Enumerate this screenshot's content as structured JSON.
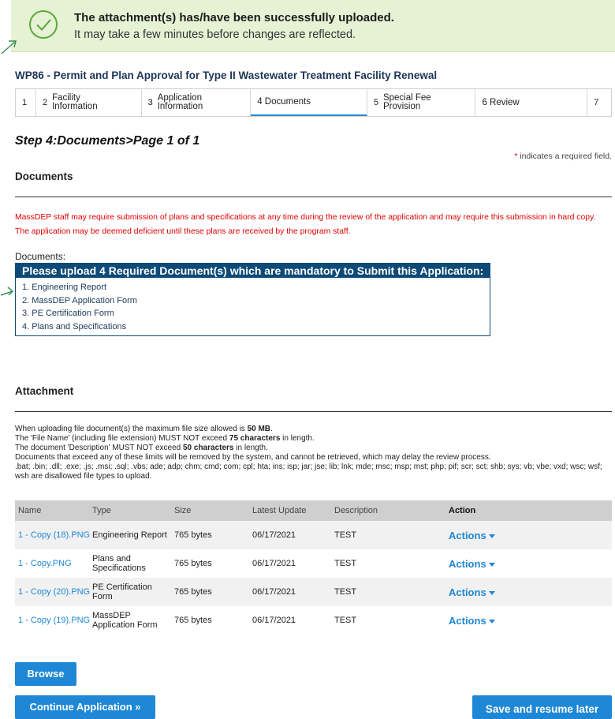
{
  "banner": {
    "title": "The attachment(s) has/have been successfully uploaded.",
    "subtitle": "It may take a few minutes before changes are reflected."
  },
  "page_title": "WP86 - Permit and Plan Approval for Type II Wastewater Treatment Facility Renewal",
  "steps": [
    {
      "num": "1",
      "label": ""
    },
    {
      "num": "2",
      "label": "Facility Information"
    },
    {
      "num": "3",
      "label": "Application Information"
    },
    {
      "num": "",
      "label": "4 Documents"
    },
    {
      "num": "5",
      "label": "Special Fee Provision"
    },
    {
      "num": "",
      "label": "6 Review"
    },
    {
      "num": "7",
      "label": ""
    }
  ],
  "step_heading": "Step 4:Documents>Page 1 of 1",
  "required_note": {
    "star": "*",
    "text": " indicates a required field."
  },
  "documents_section": {
    "title": "Documents",
    "notice": "MassDEP staff may require submission of plans and specifications at any time during the review of the application and may require this submission in hard copy. The application may be deemed deficient until these plans are received by the program staff.",
    "label": "Documents:",
    "required_header": "Please upload 4 Required Document(s) which are mandatory to Submit this Application:",
    "required_items": [
      "1. Engineering Report",
      "2. MassDEP Application Form",
      "3. PE Certification Form",
      "4. Plans and Specifications"
    ]
  },
  "attachment_section": {
    "title": "Attachment",
    "rule1_pre": "When uploading file document(s) the maximum file size allowed is ",
    "rule1_bold": "50 MB",
    "rule1_post": ".",
    "rule2_pre": "The 'File Name' (including file extension) MUST NOT exceed ",
    "rule2_bold": "75 characters",
    "rule2_post": " in length.",
    "rule3_pre": "The document 'Description' MUST NOT exceed ",
    "rule3_bold": "50 characters",
    "rule3_post": " in length.",
    "rule4": "Documents that exceed any of these limits will be removed by the system, and cannot be retrieved, which may delay the review process.",
    "rule5": ".bat; .bin; .dll; .exe; .js; .msi; .sql; .vbs; ade; adp; chm; cmd; com; cpl; hta; ins; isp; jar; jse; lib; lnk; mde; msc; msp; mst; php; pif; scr; sct; shb; sys; vb; vbe; vxd; wsc; wsf; wsh are disallowed file types to upload."
  },
  "table": {
    "headers": [
      "Name",
      "Type",
      "Size",
      "Latest Update",
      "Description",
      "Action"
    ],
    "rows": [
      {
        "name": "1 - Copy (18).PNG",
        "type": "Engineering Report",
        "size": "765 bytes",
        "date": "06/17/2021",
        "desc": "TEST",
        "action": "Actions"
      },
      {
        "name": "1 - Copy.PNG",
        "type": "Plans and Specifications",
        "size": "765 bytes",
        "date": "06/17/2021",
        "desc": "TEST",
        "action": "Actions"
      },
      {
        "name": "1 - Copy (20).PNG",
        "type": "PE Certification Form",
        "size": "765 bytes",
        "date": "06/17/2021",
        "desc": "TEST",
        "action": "Actions"
      },
      {
        "name": "1 - Copy (19).PNG",
        "type": "MassDEP Application Form",
        "size": "765 bytes",
        "date": "06/17/2021",
        "desc": "TEST",
        "action": "Actions"
      }
    ]
  },
  "buttons": {
    "browse": "Browse",
    "continue": "Continue Application »",
    "save": "Save and resume later"
  }
}
